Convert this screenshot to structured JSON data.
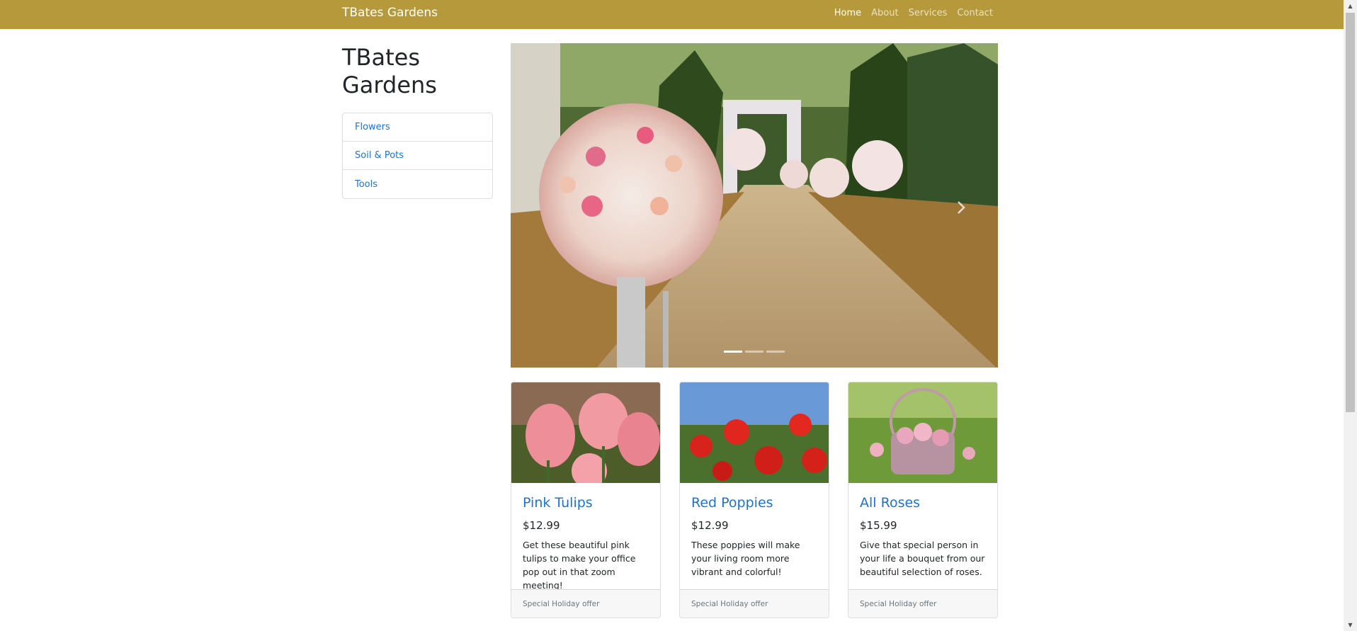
{
  "navbar": {
    "brand": "TBates Gardens",
    "links": [
      {
        "label": "Home",
        "active": true
      },
      {
        "label": "About",
        "active": false
      },
      {
        "label": "Services",
        "active": false
      },
      {
        "label": "Contact",
        "active": false
      }
    ],
    "bg_color": "#b5993b"
  },
  "sidebar": {
    "title": "TBates Gardens",
    "items": [
      {
        "label": "Flowers"
      },
      {
        "label": "Soil & Pots"
      },
      {
        "label": "Tools"
      }
    ]
  },
  "carousel": {
    "image": "wedding-aisle-flower-bouquets",
    "slide_count": 3,
    "active_slide": 1,
    "next_icon": "chevron-right-icon"
  },
  "products": [
    {
      "name": "Pink Tulips",
      "price": "$12.99",
      "description": "Get these beautiful pink tulips to make your office pop out in that zoom meeting!",
      "footer": "Special Holiday offer",
      "image": "pink-tulips"
    },
    {
      "name": "Red Poppies",
      "price": "$12.99",
      "description": "These poppies will make your living room more vibrant and colorful!",
      "footer": "Special Holiday offer",
      "image": "red-poppies"
    },
    {
      "name": "All Roses",
      "price": "$15.99",
      "description": "Give that special person in your life a bouquet from our beautiful selection of roses.",
      "footer": "Special Holiday offer",
      "image": "rose-basket"
    }
  ],
  "colors": {
    "accent": "#b5993b",
    "link": "#1a73d9"
  }
}
